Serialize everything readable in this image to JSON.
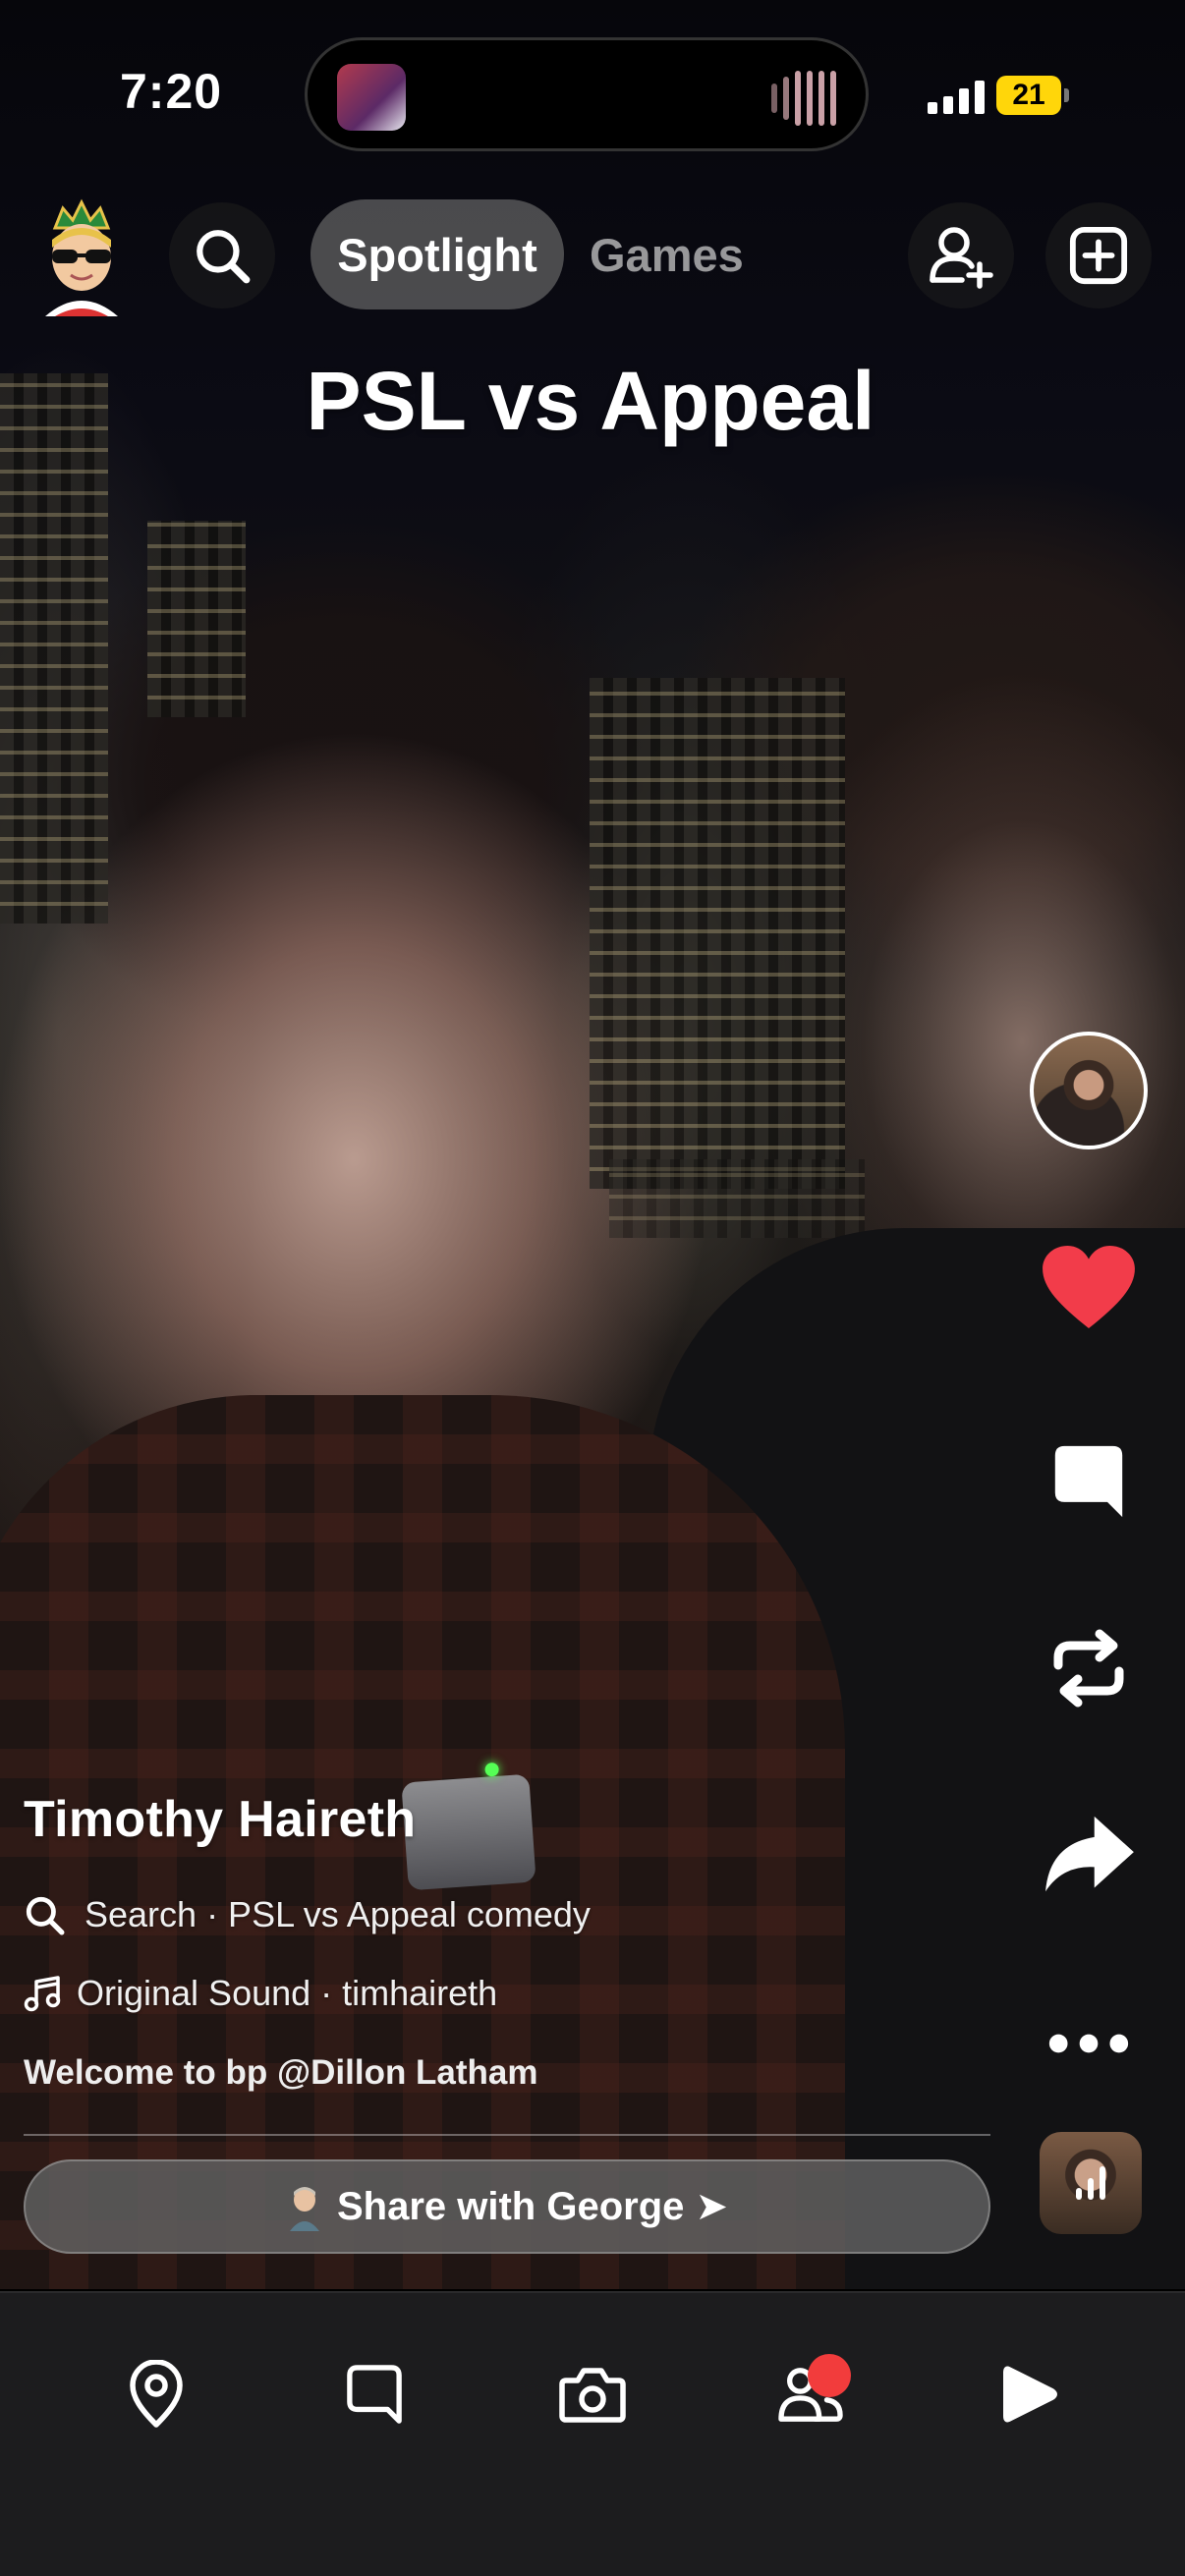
{
  "status_bar": {
    "time": "7:20",
    "battery": "21",
    "battery_color": "#ffd60a"
  },
  "top_nav": {
    "profile_avatar_icon": "bitmoji-avatar-icon",
    "search_icon": "search-icon",
    "tabs": [
      {
        "label": "Spotlight",
        "active": true
      },
      {
        "label": "Games",
        "active": false
      }
    ],
    "add_friend_icon": "add-friend-icon",
    "new_post_icon": "plus-square-icon"
  },
  "video": {
    "overlay_text": "PSL vs Appeal"
  },
  "right_rail": {
    "icons": [
      "creator-avatar",
      "heart-icon",
      "comment-icon",
      "remix-icon",
      "share-arrow-icon",
      "more-icon",
      "sound-thumbnail"
    ],
    "heart_color": "#f23c4a"
  },
  "caption": {
    "creator_name": "Timothy Haireth",
    "search_suggestion": "Search · PSL vs Appeal comedy",
    "sound": "Original Sound · timhaireth",
    "description": "Welcome to bp @Dillon Latham",
    "share_button": "Share with George ➤"
  },
  "bottom_tabs": [
    {
      "name": "map",
      "icon": "map-pin-icon"
    },
    {
      "name": "chat",
      "icon": "chat-icon"
    },
    {
      "name": "camera",
      "icon": "camera-icon"
    },
    {
      "name": "stories",
      "icon": "friends-icon",
      "badge_color": "#f23c3c"
    },
    {
      "name": "spotlight",
      "icon": "play-icon",
      "active": true
    }
  ]
}
